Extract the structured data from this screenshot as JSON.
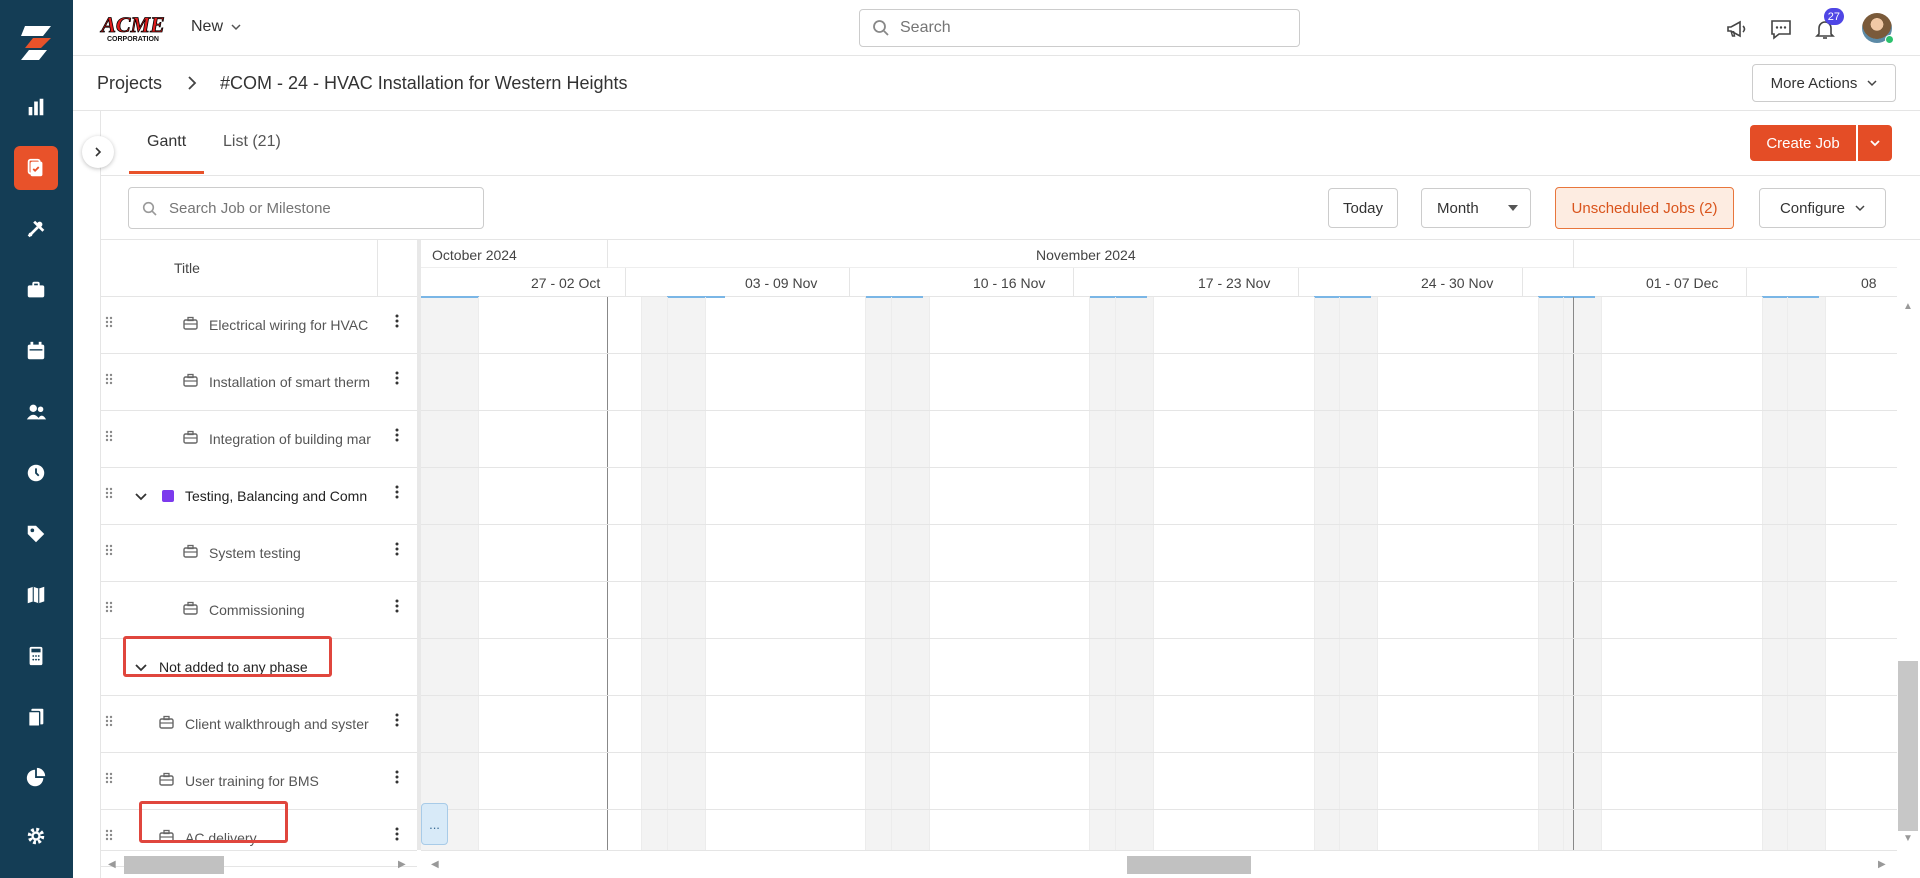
{
  "app": {
    "brand": "ACME CORPORATION",
    "brand_top": "ACME",
    "brand_bottom": "CORPORATION"
  },
  "topbar": {
    "new_label": "New",
    "search_placeholder": "Search",
    "notification_count": "27"
  },
  "breadcrumb": {
    "projects": "Projects",
    "current": "#COM - 24 - HVAC Installation for Western Heights"
  },
  "actions": {
    "more_actions": "More Actions",
    "create_job": "Create Job"
  },
  "tabs": [
    {
      "label": "Gantt",
      "active": true
    },
    {
      "label": "List (21)",
      "active": false
    }
  ],
  "toolbar": {
    "search_placeholder": "Search Job or Milestone",
    "today": "Today",
    "view": "Month",
    "unscheduled": "Unscheduled Jobs (2)",
    "configure": "Configure"
  },
  "grid": {
    "title_header": "Title",
    "rows": [
      {
        "type": "job",
        "label": "Electrical wiring for HVAC"
      },
      {
        "type": "job",
        "label": "Installation of smart therm"
      },
      {
        "type": "job",
        "label": "Integration of building mar"
      },
      {
        "type": "phase",
        "label": "Testing, Balancing and Comn"
      },
      {
        "type": "job",
        "label": "System testing"
      },
      {
        "type": "job",
        "label": "Commissioning"
      },
      {
        "type": "group",
        "label": "Not added to any phase"
      },
      {
        "type": "job",
        "label": "Client walkthrough and syster"
      },
      {
        "type": "job",
        "label": "User training for BMS"
      },
      {
        "type": "job",
        "label": "AC delivery"
      }
    ]
  },
  "timeline": {
    "months": [
      "October 2024",
      "November 2024"
    ],
    "weeks": [
      "27 - 02 Oct",
      "03 - 09 Nov",
      "10 - 16 Nov",
      "17 - 23 Nov",
      "24 - 30 Nov",
      "01 - 07 Dec",
      "08"
    ],
    "bar_label": "..."
  },
  "colors": {
    "sidebar": "#143d55",
    "accent": "#e8522a",
    "phase": "#7c3aed",
    "highlight": "#e0463d"
  }
}
